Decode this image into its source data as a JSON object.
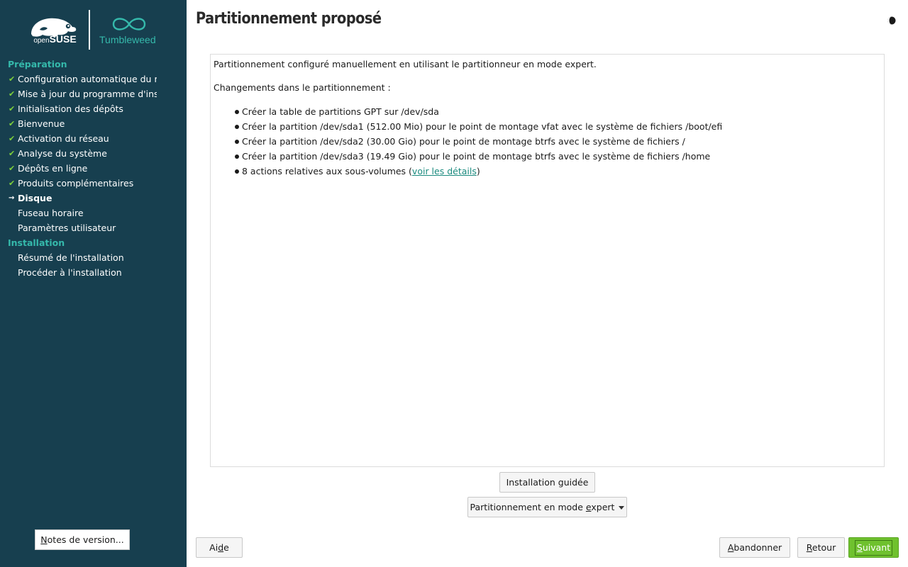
{
  "brand": {
    "suse_small": "open",
    "suse_big": "SUSE",
    "product": "Tumbleweed",
    "accent_color": "#35b9ab",
    "sidebar_bg": "#173f4f"
  },
  "sidebar": {
    "sections": [
      {
        "heading": "Préparation",
        "steps": [
          {
            "label": "Configuration automatique du réseau",
            "state": "done"
          },
          {
            "label": "Mise à jour du programme d'installation",
            "state": "done"
          },
          {
            "label": "Initialisation des dépôts",
            "state": "done"
          },
          {
            "label": "Bienvenue",
            "state": "done"
          },
          {
            "label": "Activation du réseau",
            "state": "done"
          },
          {
            "label": "Analyse du système",
            "state": "done"
          },
          {
            "label": "Dépôts en ligne",
            "state": "done"
          },
          {
            "label": "Produits complémentaires",
            "state": "done"
          },
          {
            "label": "Disque",
            "state": "current"
          },
          {
            "label": "Fuseau horaire",
            "state": "pending"
          },
          {
            "label": "Paramètres utilisateur",
            "state": "pending"
          }
        ]
      },
      {
        "heading": "Installation",
        "steps": [
          {
            "label": "Résumé de l'installation",
            "state": "pending"
          },
          {
            "label": "Procéder à l'installation",
            "state": "pending"
          }
        ]
      }
    ],
    "notes_button": {
      "mnemonic": "N",
      "rest": "otes de version..."
    }
  },
  "header": {
    "title": "Partitionnement proposé",
    "theme_icon": "half-moon-icon"
  },
  "content": {
    "intro": "Partitionnement configuré manuellement en utilisant le partitionneur en mode expert.",
    "changes_title": "Changements dans le partitionnement :",
    "changes": [
      "Créer la table de partitions GPT sur /dev/sda",
      "Créer la partition /dev/sda1 (512.00 Mio) pour le point de montage vfat avec le système de fichiers /boot/efi",
      "Créer la partition /dev/sda2 (30.00 Gio) pour le point de montage btrfs avec le système de fichiers /",
      "Créer la partition /dev/sda3 (19.49 Gio) pour le point de montage btrfs avec le système de fichiers /home"
    ],
    "subvolume_prefix": "8 actions relatives aux sous-volumes (",
    "subvolume_link": "voir les détails",
    "subvolume_suffix": ")"
  },
  "buttons": {
    "guided": "Installation guidée",
    "expert_before": "Partitionnement en mode ",
    "expert_mnemonic": "e",
    "expert_after": "xpert",
    "help_before": "Ai",
    "help_mnemonic": "d",
    "help_after": "e",
    "abort_mnemonic": "A",
    "abort_rest": "bandonner",
    "back_mnemonic": "R",
    "back_rest": "etour",
    "next_mnemonic": "S",
    "next_rest": "uivant",
    "next_color": "#6fc12e"
  }
}
